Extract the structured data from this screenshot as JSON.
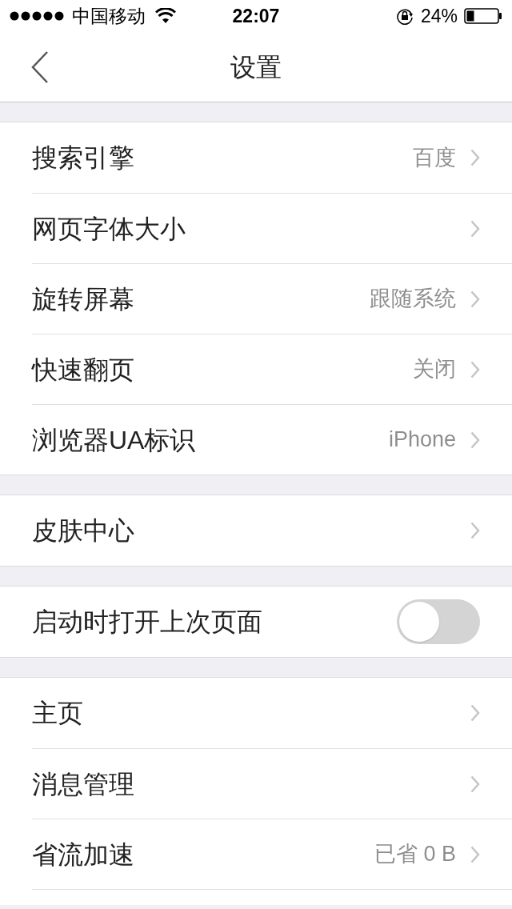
{
  "status_bar": {
    "carrier": "中国移动",
    "time": "22:07",
    "battery": "24%"
  },
  "nav": {
    "title": "设置"
  },
  "groups": [
    {
      "items": [
        {
          "kind": "link",
          "label": "搜索引擎",
          "value": "百度"
        },
        {
          "kind": "link",
          "label": "网页字体大小"
        },
        {
          "kind": "link",
          "label": "旋转屏幕",
          "value": "跟随系统"
        },
        {
          "kind": "link",
          "label": "快速翻页",
          "value": "关闭"
        },
        {
          "kind": "link",
          "label": "浏览器UA标识",
          "value": "iPhone"
        }
      ]
    },
    {
      "items": [
        {
          "kind": "link",
          "label": "皮肤中心"
        }
      ]
    },
    {
      "items": [
        {
          "kind": "toggle",
          "label": "启动时打开上次页面",
          "on": false
        }
      ]
    },
    {
      "items": [
        {
          "kind": "link",
          "label": "主页"
        },
        {
          "kind": "link",
          "label": "消息管理"
        },
        {
          "kind": "link",
          "label": "省流加速",
          "value": "已省 0 B"
        },
        {
          "kind": "cut"
        }
      ]
    }
  ]
}
